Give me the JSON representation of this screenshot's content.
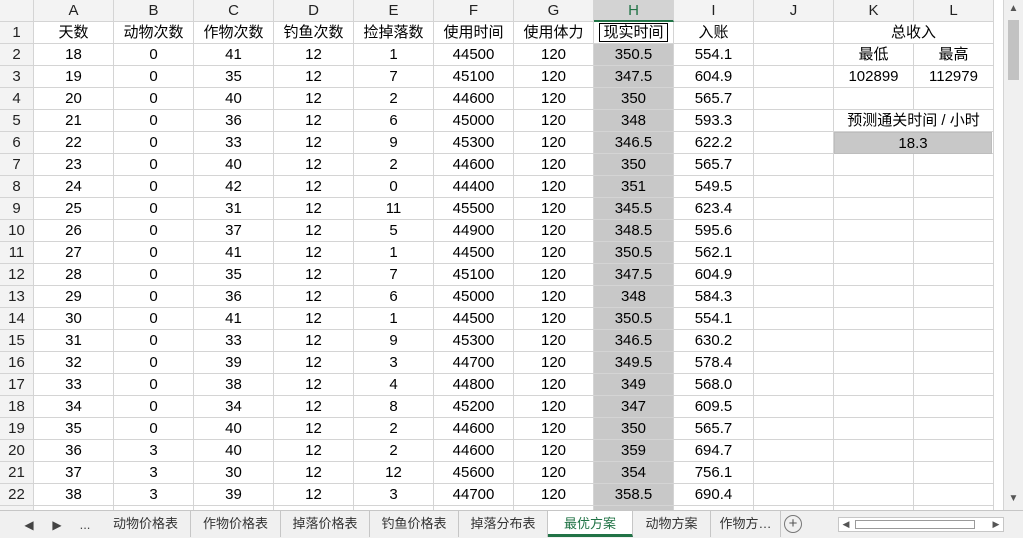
{
  "columns": [
    "A",
    "B",
    "C",
    "D",
    "E",
    "F",
    "G",
    "H",
    "I",
    "J",
    "K",
    "L"
  ],
  "selected_column": "H",
  "table": {
    "headers": [
      "天数",
      "动物次数",
      "作物次数",
      "钓鱼次数",
      "捡掉落数",
      "使用时间",
      "使用体力",
      "现实时间",
      "入账"
    ],
    "rows": [
      [
        "18",
        "0",
        "41",
        "12",
        "1",
        "44500",
        "120",
        "350.5",
        "554.1"
      ],
      [
        "19",
        "0",
        "35",
        "12",
        "7",
        "45100",
        "120",
        "347.5",
        "604.9"
      ],
      [
        "20",
        "0",
        "40",
        "12",
        "2",
        "44600",
        "120",
        "350",
        "565.7"
      ],
      [
        "21",
        "0",
        "36",
        "12",
        "6",
        "45000",
        "120",
        "348",
        "593.3"
      ],
      [
        "22",
        "0",
        "33",
        "12",
        "9",
        "45300",
        "120",
        "346.5",
        "622.2"
      ],
      [
        "23",
        "0",
        "40",
        "12",
        "2",
        "44600",
        "120",
        "350",
        "565.7"
      ],
      [
        "24",
        "0",
        "42",
        "12",
        "0",
        "44400",
        "120",
        "351",
        "549.5"
      ],
      [
        "25",
        "0",
        "31",
        "12",
        "11",
        "45500",
        "120",
        "345.5",
        "623.4"
      ],
      [
        "26",
        "0",
        "37",
        "12",
        "5",
        "44900",
        "120",
        "348.5",
        "595.6"
      ],
      [
        "27",
        "0",
        "41",
        "12",
        "1",
        "44500",
        "120",
        "350.5",
        "562.1"
      ],
      [
        "28",
        "0",
        "35",
        "12",
        "7",
        "45100",
        "120",
        "347.5",
        "604.9"
      ],
      [
        "29",
        "0",
        "36",
        "12",
        "6",
        "45000",
        "120",
        "348",
        "584.3"
      ],
      [
        "30",
        "0",
        "41",
        "12",
        "1",
        "44500",
        "120",
        "350.5",
        "554.1"
      ],
      [
        "31",
        "0",
        "33",
        "12",
        "9",
        "45300",
        "120",
        "346.5",
        "630.2"
      ],
      [
        "32",
        "0",
        "39",
        "12",
        "3",
        "44700",
        "120",
        "349.5",
        "578.4"
      ],
      [
        "33",
        "0",
        "38",
        "12",
        "4",
        "44800",
        "120",
        "349",
        "568.0"
      ],
      [
        "34",
        "0",
        "34",
        "12",
        "8",
        "45200",
        "120",
        "347",
        "609.5"
      ],
      [
        "35",
        "0",
        "40",
        "12",
        "2",
        "44600",
        "120",
        "350",
        "565.7"
      ],
      [
        "36",
        "3",
        "40",
        "12",
        "2",
        "44600",
        "120",
        "359",
        "694.7"
      ],
      [
        "37",
        "3",
        "30",
        "12",
        "12",
        "45600",
        "120",
        "354",
        "756.1"
      ],
      [
        "38",
        "3",
        "39",
        "12",
        "3",
        "44700",
        "120",
        "358.5",
        "690.4"
      ]
    ]
  },
  "summary": {
    "total_income_label": "总收入",
    "min_label": "最低",
    "max_label": "最高",
    "min_value": "102899",
    "max_value": "112979",
    "clear_time_label": "预测通关时间 / 小时",
    "clear_time_value": "18.3"
  },
  "tabs": {
    "ellipsis": "...",
    "items": [
      "动物价格表",
      "作物价格表",
      "掉落价格表",
      "钓鱼价格表",
      "掉落分布表",
      "最优方案",
      "动物方案",
      "作物方…"
    ],
    "active_index": 5
  },
  "colors": {
    "accent": "#217346",
    "highlight_column": "#c8c8c8",
    "header_bg": "#f3f3f3"
  }
}
